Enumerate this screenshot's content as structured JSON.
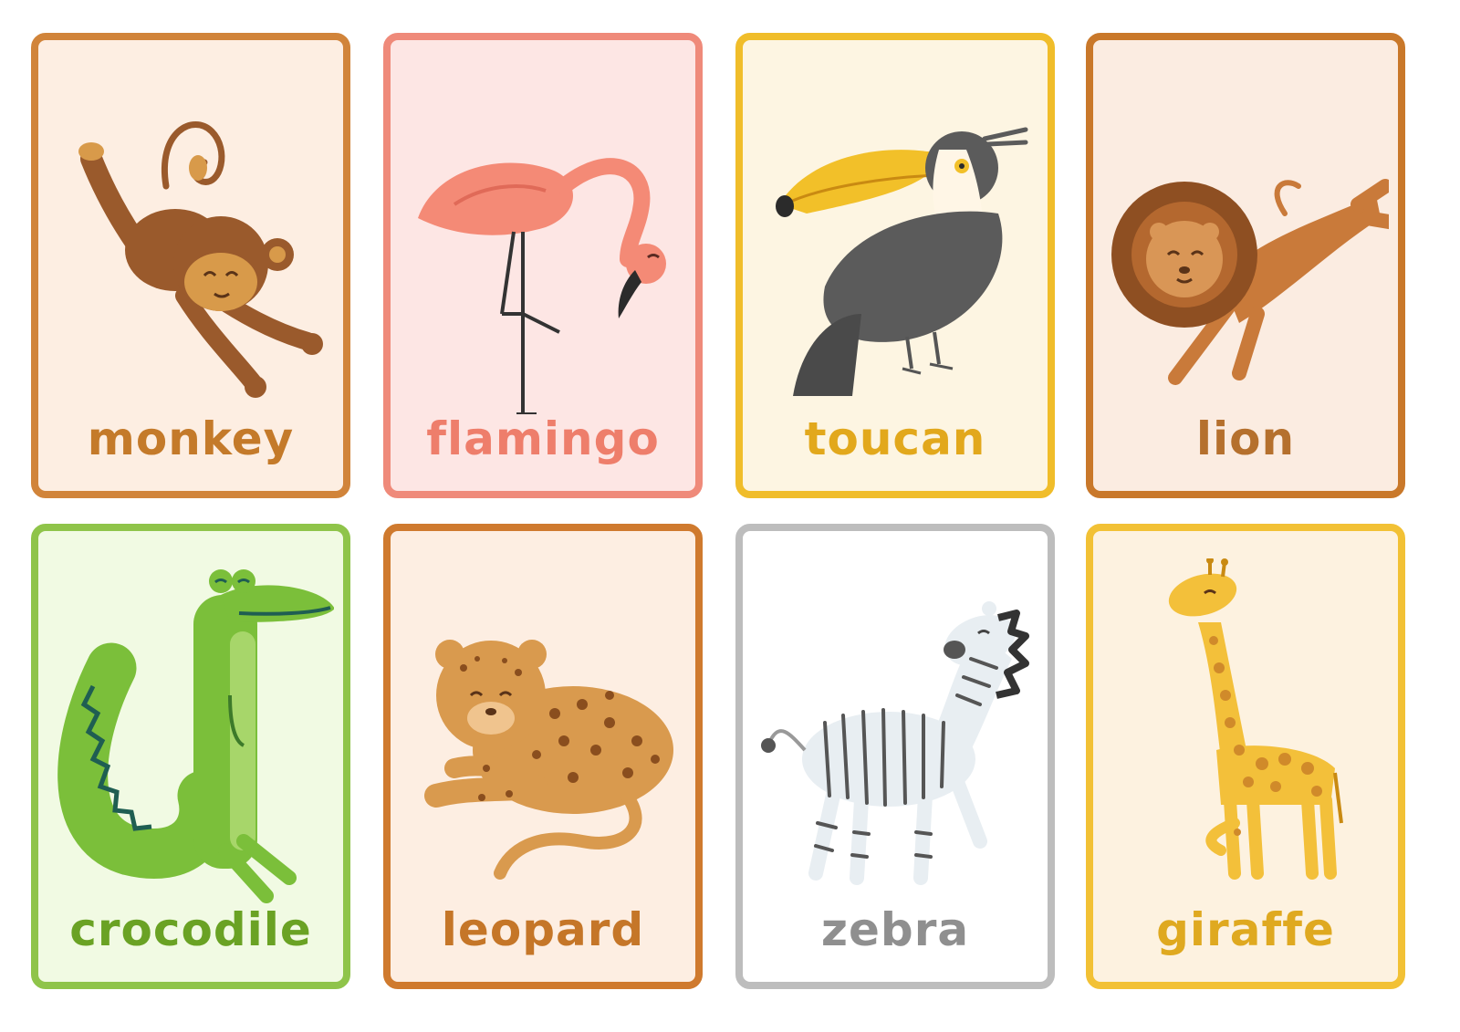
{
  "cards": [
    {
      "label": "monkey",
      "icon": "monkey-icon",
      "border": "#d1843a",
      "bg": "#fdeee2",
      "text": "#c47a2a"
    },
    {
      "label": "flamingo",
      "icon": "flamingo-icon",
      "border": "#ef8a7a",
      "bg": "#fde6e4",
      "text": "#ee7e6b"
    },
    {
      "label": "toucan",
      "icon": "toucan-icon",
      "border": "#f0bd2a",
      "bg": "#fdf5e2",
      "text": "#e2a81c"
    },
    {
      "label": "lion",
      "icon": "lion-icon",
      "border": "#c9782a",
      "bg": "#fbece1",
      "text": "#b5702d"
    },
    {
      "label": "crocodile",
      "icon": "crocodile-icon",
      "border": "#8fc44a",
      "bg": "#f1fae3",
      "text": "#6aa224"
    },
    {
      "label": "leopard",
      "icon": "leopard-icon",
      "border": "#cf7a2e",
      "bg": "#fdeee2",
      "text": "#c57628"
    },
    {
      "label": "zebra",
      "icon": "zebra-icon",
      "border": "#bdbdbd",
      "bg": "#ffffff",
      "text": "#8f8f8f"
    },
    {
      "label": "giraffe",
      "icon": "giraffe-icon",
      "border": "#f2c135",
      "bg": "#fdf2e0",
      "text": "#dfa920"
    }
  ]
}
